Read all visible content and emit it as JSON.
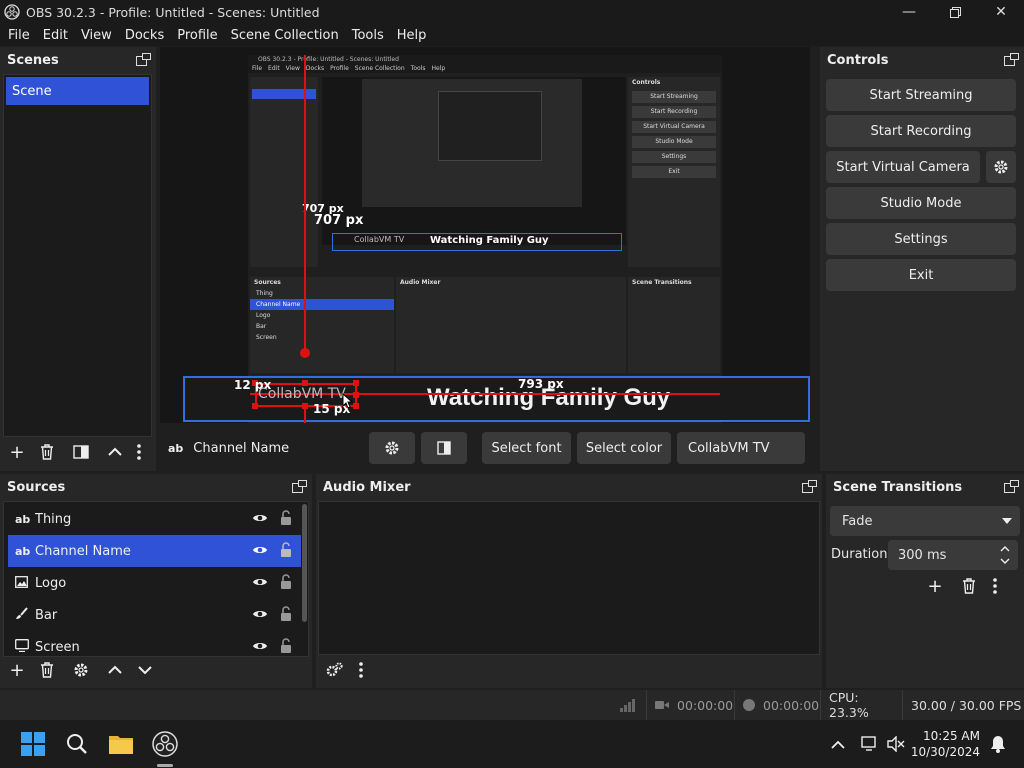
{
  "window": {
    "title": "OBS 30.2.3 - Profile: Untitled - Scenes: Untitled"
  },
  "menu": [
    "File",
    "Edit",
    "View",
    "Docks",
    "Profile",
    "Scene Collection",
    "Tools",
    "Help"
  ],
  "scenes": {
    "title": "Scenes",
    "items": [
      "Scene"
    ]
  },
  "preview": {
    "measure_top": "707 px",
    "measure_left": "12 px",
    "measure_bottom": "15 px",
    "measure_right": "793 px",
    "source_text": "CollabVM TV",
    "overlay_text": "Watching Family Guy",
    "nested_title": "OBS 30.2.3 - Profile: Untitled - Scenes: Untitled",
    "nested_menu": [
      "File",
      "Edit",
      "View",
      "Docks",
      "Profile",
      "Scene Collection",
      "Tools",
      "Help"
    ],
    "nested_controls": [
      "Start Streaming",
      "Start Recording",
      "Start Virtual Camera",
      "Studio Mode",
      "Settings",
      "Exit"
    ],
    "nested_sources": [
      "Thing",
      "Channel Name",
      "Logo",
      "Bar",
      "Screen"
    ]
  },
  "source_toolbar": {
    "icon_label": "ab",
    "name": "Channel Name",
    "select_font": "Select font",
    "select_color": "Select color",
    "text_value": "CollabVM TV"
  },
  "controls": {
    "title": "Controls",
    "start_streaming": "Start Streaming",
    "start_recording": "Start Recording",
    "start_virtual_camera": "Start Virtual Camera",
    "studio_mode": "Studio Mode",
    "settings": "Settings",
    "exit": "Exit"
  },
  "sources": {
    "title": "Sources",
    "items": [
      {
        "icon": "ab",
        "name": "Thing"
      },
      {
        "icon": "ab",
        "name": "Channel Name"
      },
      {
        "icon": "image",
        "name": "Logo"
      },
      {
        "icon": "brush",
        "name": "Bar"
      },
      {
        "icon": "monitor",
        "name": "Screen"
      }
    ]
  },
  "mixer": {
    "title": "Audio Mixer"
  },
  "transitions": {
    "title": "Scene Transitions",
    "selected": "Fade",
    "duration_label": "Duration",
    "duration_value": "300 ms"
  },
  "status": {
    "rec_time": "00:00:00",
    "stream_time": "00:00:00",
    "cpu": "CPU: 23.3%",
    "fps": "30.00 / 30.00 FPS"
  },
  "taskbar": {
    "time": "10:25 AM",
    "date": "10/30/2024"
  },
  "colors": {
    "accent": "#2f52d6",
    "measure": "#e01010",
    "bg": "#1f1f1f",
    "dock": "#272727"
  }
}
